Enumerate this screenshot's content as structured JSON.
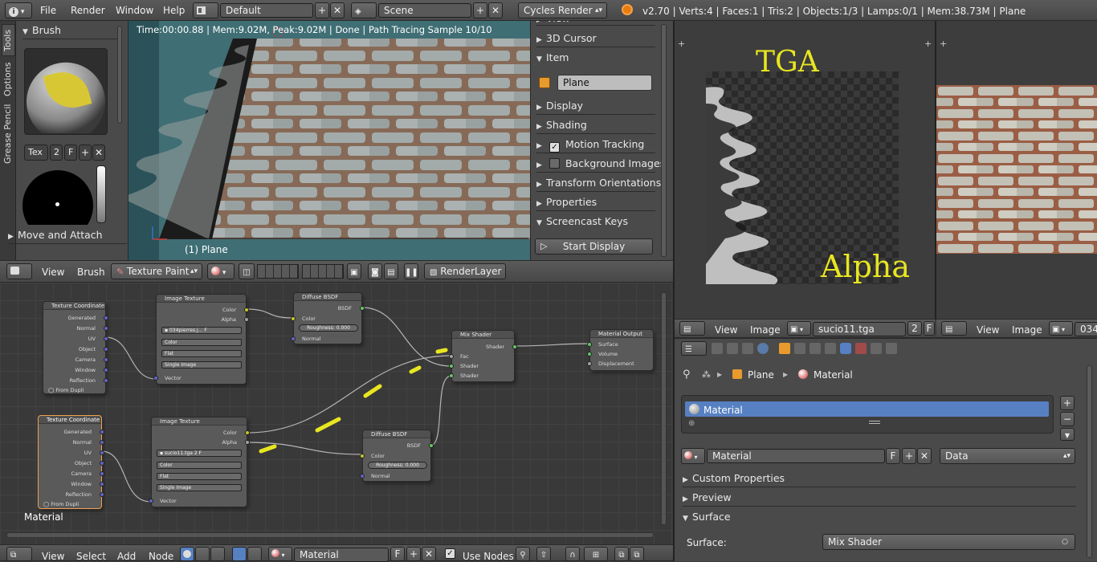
{
  "topbar": {
    "menus": [
      "File",
      "Render",
      "Window",
      "Help"
    ],
    "screen_layout": "Default",
    "scene": "Scene",
    "render_engine": "Cycles Render",
    "stats": "v2.70 | Verts:4 | Faces:1 | Tris:2 | Objects:1/3 | Lamps:0/1 | Mem:38.73M | Plane"
  },
  "tool_tabs": [
    "Tools",
    "Options",
    "Grease Pencil"
  ],
  "brush_panel": {
    "title": "Brush",
    "tex_label": "Tex",
    "tex_users": "2",
    "fake_user": "F",
    "move_attach": "Move and Attach"
  },
  "viewport": {
    "render_info": "Time:00:00.88 | Mem:9.02M, Peak:9.02M | Done | Path Tracing Sample 10/10",
    "object_label": "(1) Plane"
  },
  "properties_n": {
    "view_partial": "View",
    "panels_top": [
      "3D Cursor",
      "Item"
    ],
    "item_name": "Plane",
    "panels": [
      "Display",
      "Shading",
      "Motion Tracking",
      "Background Images",
      "Transform Orientations",
      "Properties",
      "Screencast Keys"
    ],
    "start_display": "Start Display"
  },
  "view3d_header": {
    "view": "View",
    "brush": "Brush",
    "mode": "Texture Paint",
    "renderlayer": "RenderLayer"
  },
  "node_editor": {
    "material_label": "Material",
    "nodes": {
      "tc1": {
        "title": "Texture Coordinate",
        "outputs": [
          "Generated",
          "Normal",
          "UV",
          "Object",
          "Camera",
          "Window",
          "Reflection"
        ],
        "from_dupli": "From Dupli"
      },
      "tc2": {
        "title": "Texture Coordinate",
        "outputs": [
          "Generated",
          "Normal",
          "UV",
          "Object",
          "Camera",
          "Window",
          "Reflection"
        ],
        "from_dupli": "From Dupli"
      },
      "img1": {
        "title": "Image Texture",
        "out_color": "Color",
        "out_alpha": "Alpha",
        "image": "034pierres.j...",
        "users": "F",
        "color": "Color",
        "proj": "Flat",
        "src": "Single Image",
        "vector": "Vector"
      },
      "img2": {
        "title": "Image Texture",
        "out_color": "Color",
        "out_alpha": "Alpha",
        "image": "sucio11.tga",
        "users": "2",
        "f": "F",
        "color": "Color",
        "proj": "Flat",
        "src": "Single Image",
        "vector": "Vector"
      },
      "diff1": {
        "title": "Diffuse BSDF",
        "bsdf": "BSDF",
        "color": "Color",
        "roughness": "Roughness: 0.000",
        "normal": "Normal"
      },
      "diff2": {
        "title": "Diffuse BSDF",
        "bsdf": "BSDF",
        "color": "Color",
        "roughness": "Roughness: 0.000",
        "normal": "Normal"
      },
      "mix": {
        "title": "Mix Shader",
        "shader_out": "Shader",
        "fac": "Fac",
        "shader1": "Shader",
        "shader2": "Shader"
      },
      "out": {
        "title": "Material Output",
        "surface": "Surface",
        "volume": "Volume",
        "displacement": "Displacement"
      }
    }
  },
  "node_header": {
    "view": "View",
    "select": "Select",
    "add": "Add",
    "node": "Node",
    "material": "Material",
    "f": "F",
    "use_nodes": "Use Nodes"
  },
  "image_editor_left": {
    "label_top": "TGA",
    "label_bottom": "Alpha",
    "view": "View",
    "image": "Image",
    "image_name": "sucio11.tga",
    "users": "2",
    "f": "F"
  },
  "image_editor_right": {
    "view": "View",
    "image": "Image",
    "image_name": "034p"
  },
  "material_props": {
    "breadcrumb_object": "Plane",
    "breadcrumb_material": "Material",
    "slot_name": "Material",
    "material_name": "Material",
    "f": "F",
    "link": "Data",
    "panels": [
      "Custom Properties",
      "Preview",
      "Surface"
    ],
    "surface_label": "Surface:",
    "surface_value": "Mix Shader"
  },
  "colors": {
    "accent_selection": "#5680c2",
    "highlight_yellow": "#e8e620",
    "socket_yellow": "#c7c729",
    "socket_green": "#63c763",
    "socket_purple": "#6363c7",
    "socket_gray": "#a1a1a1"
  }
}
